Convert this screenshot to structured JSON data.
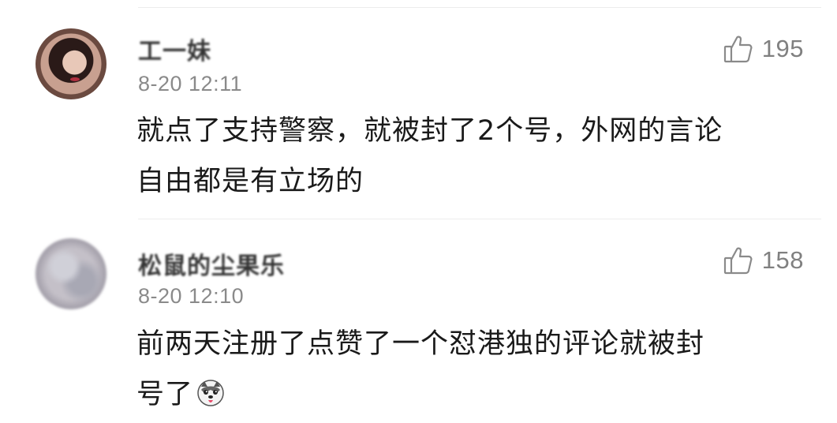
{
  "comments": [
    {
      "username": "工一妹",
      "timestamp": "8-20 12:11",
      "likes": "195",
      "text_lines": [
        "就点了支持警察，就被封了2个号，外网的言论",
        "自由都是有立场的"
      ],
      "avatar_icon": "profile-photo-woman"
    },
    {
      "username": "松鼠的尘果乐",
      "timestamp": "8-20 12:10",
      "likes": "158",
      "text_lines": [
        "前两天注册了点赞了一个怼港独的评论就被封",
        "号了"
      ],
      "trailing_emoji": "husky-dog-emoji",
      "avatar_icon": "profile-photo-blurred"
    }
  ],
  "colors": {
    "text": "#1a1a1a",
    "meta": "#8a8a8a",
    "like": "#808080",
    "divider": "#ececec"
  }
}
